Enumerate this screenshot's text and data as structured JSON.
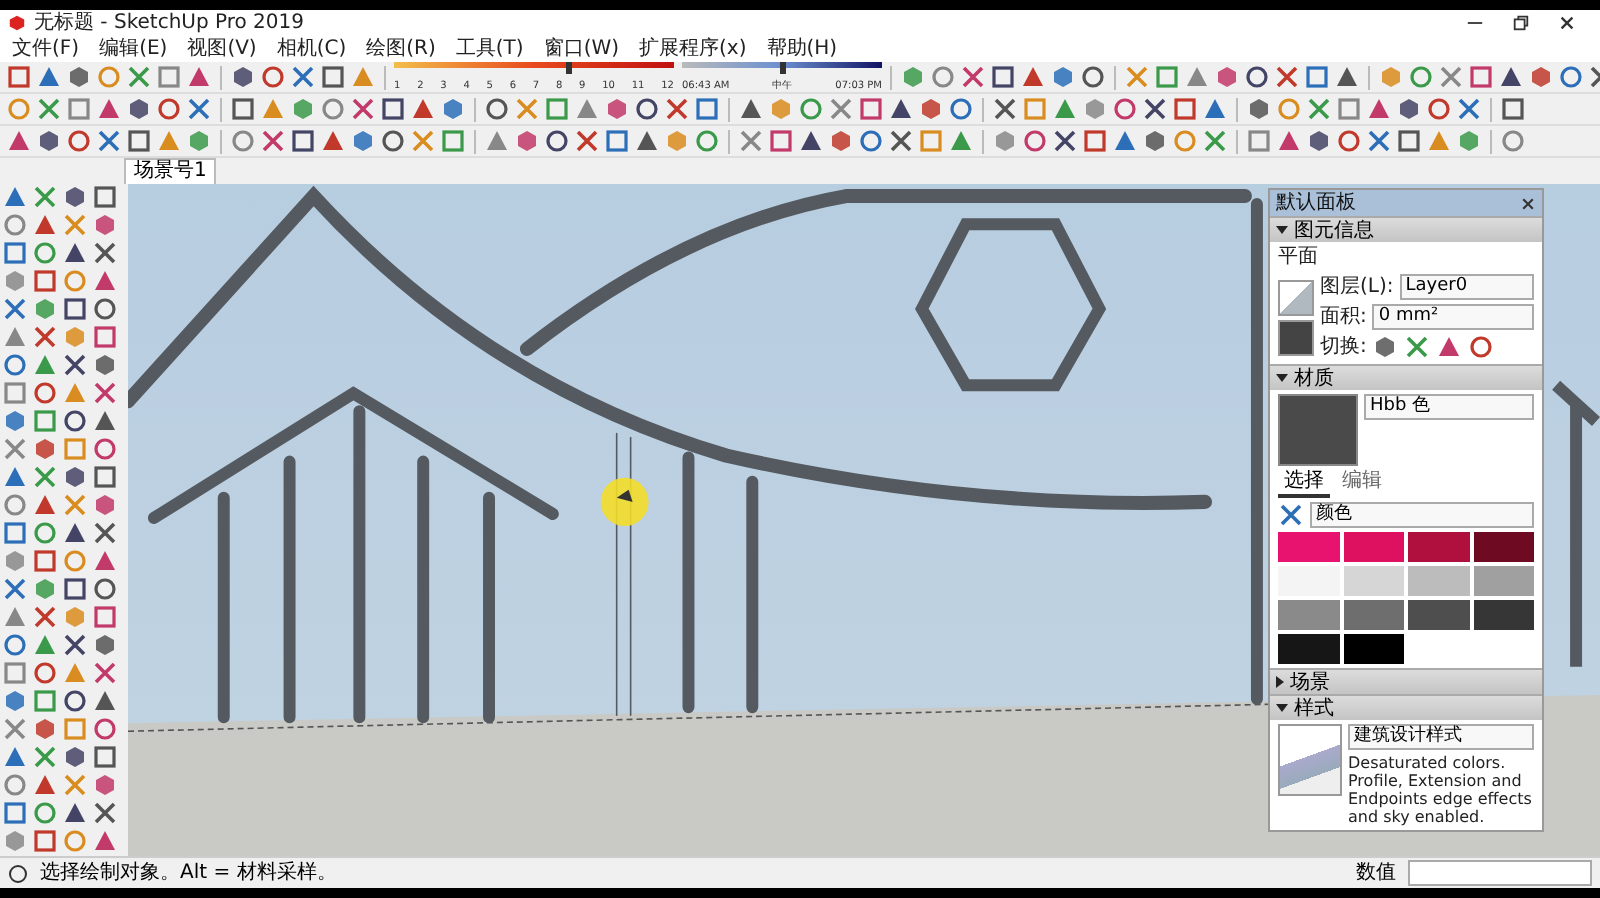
{
  "window": {
    "title": "无标题 - SketchUp Pro 2019"
  },
  "menu": [
    "文件(F)",
    "编辑(E)",
    "视图(V)",
    "相机(C)",
    "绘图(R)",
    "工具(T)",
    "窗口(W)",
    "扩展程序(x)",
    "帮助(H)"
  ],
  "shadow": {
    "month_slider": {
      "level": 0.62
    },
    "time_slider": {
      "level": 0.5
    },
    "months": [
      "1",
      "2",
      "3",
      "4",
      "5",
      "6",
      "7",
      "8",
      "9",
      "10",
      "11",
      "12"
    ],
    "time_start": "06:43 AM",
    "time_mid": "中午",
    "time_end": "07:03 PM"
  },
  "scene_tabs": [
    {
      "label": "场景号1",
      "selected": true
    }
  ],
  "tray": {
    "title": "默认面板",
    "entity_info": {
      "header": "图元信息",
      "expanded": true,
      "type": "平面",
      "layer_label": "图层(L):",
      "layer_value": "Layer0",
      "area_label": "面积:",
      "area_value": "0 mm²",
      "toggle_label": "切换:"
    },
    "materials": {
      "header": "材质",
      "expanded": true,
      "name": "Hbb 色",
      "tabs": [
        {
          "label": "选择",
          "selected": true
        },
        {
          "label": "编辑",
          "selected": false
        }
      ],
      "collection": "颜色",
      "swatches": [
        {
          "color": "#e8136e"
        },
        {
          "color": "#de1060"
        },
        {
          "color": "#b0103e"
        },
        {
          "color": "#6e0a22"
        },
        {
          "color": "#f4f4f4"
        },
        {
          "color": "#d6d6d6"
        },
        {
          "color": "#bcbcbc"
        },
        {
          "color": "#a0a0a0"
        },
        {
          "color": "#8a8a8a"
        },
        {
          "color": "#6e6e6e"
        },
        {
          "color": "#4e4e4e"
        },
        {
          "color": "#363636"
        },
        {
          "color": "#161616"
        },
        {
          "color": "#000000"
        }
      ]
    },
    "scenes": {
      "header": "场景",
      "expanded": false
    },
    "styles": {
      "header": "样式",
      "expanded": true,
      "name": "建筑设计样式",
      "description": "Desaturated colors. Profile, Extension and Endpoints edge effects and sky enabled."
    }
  },
  "status_bar": {
    "hint": "选择绘制对象。Alt = 材料采样。",
    "measurements_label": "数值"
  }
}
